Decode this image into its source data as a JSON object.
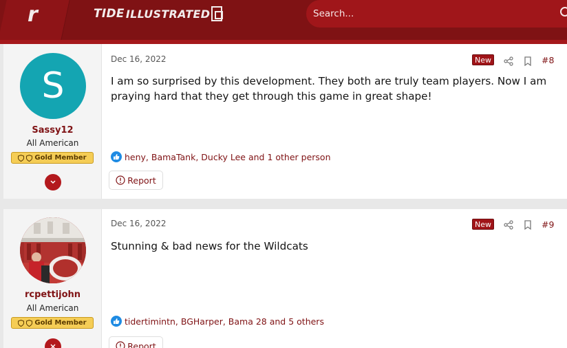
{
  "header": {
    "site_name_bold": "TIDE",
    "site_name_rest": "ILLUSTRATED",
    "logo_letter": "r",
    "search_placeholder": "Search..."
  },
  "icons": {
    "search": "search-icon",
    "share": "share-icon",
    "bookmark": "bookmark-icon",
    "like": "thumbs-up-icon",
    "report": "alert-circle-icon",
    "expand": "chevron-down-icon",
    "badge_shield": "shield-icon"
  },
  "colors": {
    "brand": "#7f1214",
    "brand_light": "#a0161a",
    "avatar_teal": "#14a5b2",
    "gold": "#f5cd56",
    "like_blue": "#1f8be3"
  },
  "posts": [
    {
      "avatar_letter": "S",
      "username": "Sassy12",
      "user_title": "All American",
      "badge": "Gold Member",
      "date": "Dec 16, 2022",
      "new_label": "New",
      "post_number": "#8",
      "body": "I am so surprised by this development. They both are truly team players. Now I am praying hard that they get through this game in great shape!",
      "reactions": "heny, BamaTank, Ducky Lee and 1 other person",
      "report_label": "Report"
    },
    {
      "avatar_letter": "",
      "username": "rcpettijohn",
      "user_title": "All American",
      "badge": "Gold Member",
      "date": "Dec 16, 2022",
      "new_label": "New",
      "post_number": "#9",
      "body": "Stunning & bad news for the Wildcats",
      "reactions": "tidertimintn, BGHarper, Bama 28 and 5 others",
      "report_label": "Report"
    }
  ]
}
